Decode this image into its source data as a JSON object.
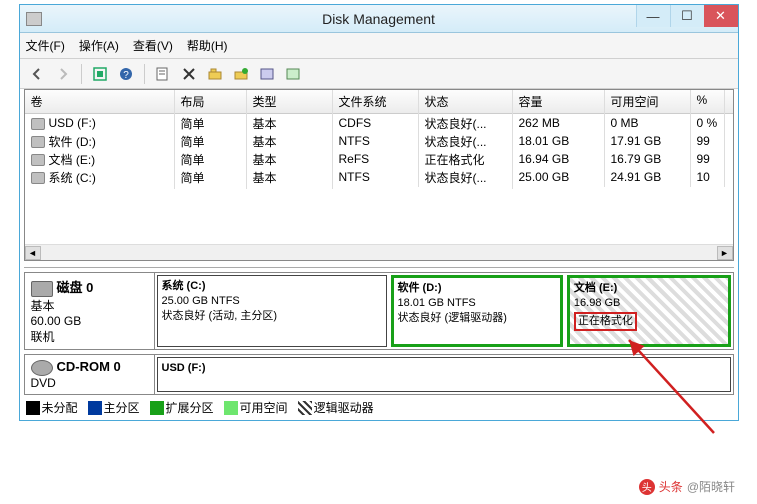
{
  "window": {
    "title": "Disk Management"
  },
  "menu": {
    "file": "文件(F)",
    "action": "操作(A)",
    "view": "查看(V)",
    "help": "帮助(H)"
  },
  "columns": {
    "vol": "卷",
    "layout": "布局",
    "type": "类型",
    "fs": "文件系统",
    "status": "状态",
    "cap": "容量",
    "free": "可用空间",
    "pct": "%"
  },
  "volumes": [
    {
      "name": "USD (F:)",
      "layout": "简单",
      "type": "基本",
      "fs": "CDFS",
      "status": "状态良好(...",
      "cap": "262 MB",
      "free": "0 MB",
      "pct": "0 %"
    },
    {
      "name": "软件 (D:)",
      "layout": "简单",
      "type": "基本",
      "fs": "NTFS",
      "status": "状态良好(...",
      "cap": "18.01 GB",
      "free": "17.91 GB",
      "pct": "99"
    },
    {
      "name": "文档 (E:)",
      "layout": "简单",
      "type": "基本",
      "fs": "ReFS",
      "status": "正在格式化",
      "cap": "16.94 GB",
      "free": "16.79 GB",
      "pct": "99"
    },
    {
      "name": "系统 (C:)",
      "layout": "简单",
      "type": "基本",
      "fs": "NTFS",
      "status": "状态良好(...",
      "cap": "25.00 GB",
      "free": "24.91 GB",
      "pct": "10"
    }
  ],
  "disk0": {
    "label": "磁盘 0",
    "type": "基本",
    "size": "60.00 GB",
    "state": "联机",
    "parts": [
      {
        "title": "系统  (C:)",
        "line1": "25.00 GB NTFS",
        "line2": "状态良好 (活动, 主分区)"
      },
      {
        "title": "软件  (D:)",
        "line1": "18.01 GB NTFS",
        "line2": "状态良好 (逻辑驱动器)"
      },
      {
        "title": "文档  (E:)",
        "line1": "16.98 GB",
        "line2": "正在格式化"
      }
    ]
  },
  "cdrom": {
    "label": "CD-ROM 0",
    "type": "DVD",
    "part": "USD  (F:)"
  },
  "legend": {
    "unalloc": "未分配",
    "primary": "主分区",
    "extended": "扩展分区",
    "free": "可用空间",
    "logical": "逻辑驱动器"
  },
  "watermark": {
    "prefix": "头条",
    "handle": "@陌晓轩"
  }
}
